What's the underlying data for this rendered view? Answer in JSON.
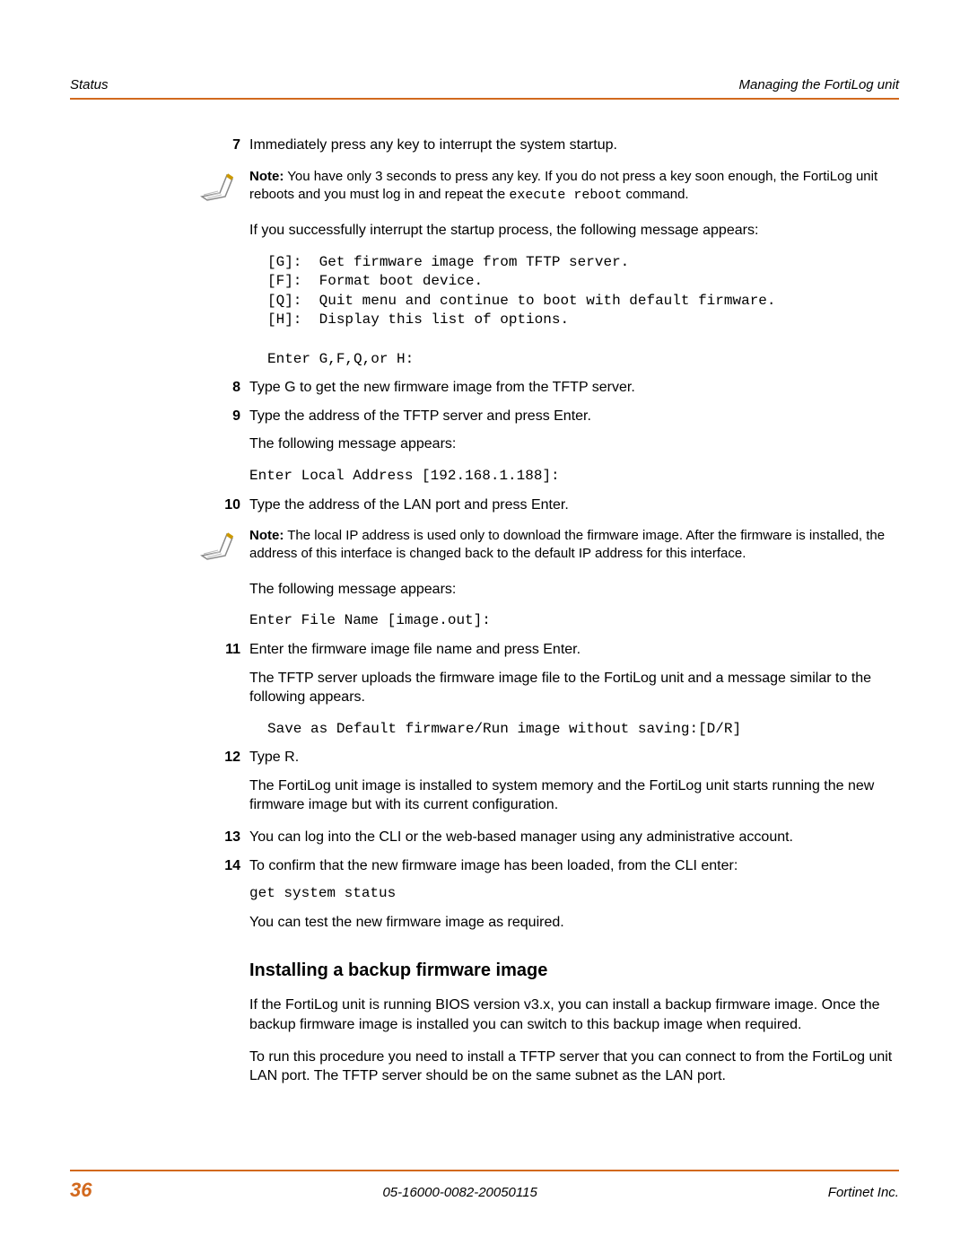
{
  "header": {
    "left": "Status",
    "right": "Managing the FortiLog unit"
  },
  "steps": {
    "s7": "Immediately press any key to interrupt the system startup.",
    "note1_pre": "Note:",
    "note1_text": " You have only 3 seconds to press any key. If you do not press a key soon enough, the FortiLog unit reboots and you must log in and repeat the ",
    "note1_cmd": "execute reboot",
    "note1_post": " command.",
    "interrupt_msg": "If you successfully interrupt the startup process, the following message appears:",
    "code_menu": "[G]:  Get firmware image from TFTP server.\n[F]:  Format boot device.\n[Q]:  Quit menu and continue to boot with default firmware.\n[H]:  Display this list of options.\n\nEnter G,F,Q,or H:",
    "s8": "Type G to get the new firmware image from the TFTP server.",
    "s9": "Type the address of the TFTP server and press Enter.",
    "s9_msg": "The following message appears:",
    "s9_code": "Enter Local Address [192.168.1.188]:",
    "s10": "Type the address of the LAN port and press Enter.",
    "note2_pre": "Note:",
    "note2_text": " The local IP address is used only to download the firmware image. After the firmware is installed, the address of this interface is changed back to the default IP address for this interface.",
    "s10_msg": "The following message appears:",
    "s10_code": "Enter File Name [image.out]:",
    "s11": "Enter the firmware image file name and press Enter.",
    "s11_p": "The TFTP server uploads the firmware image file to the FortiLog unit and a message similar to the following appears.",
    "s11_code": "Save as Default firmware/Run image without saving:[D/R]",
    "s12": "Type R.",
    "s12_p": "The FortiLog unit image is installed to system memory and the FortiLog unit starts running the new firmware image but with its current configuration.",
    "s13": "You can log into the CLI or the web-based manager using any administrative account.",
    "s14": "To confirm that the new firmware image has been loaded, from the CLI enter:",
    "s14_code": "get system status",
    "s14_p": "You can test the new firmware image as required."
  },
  "section": {
    "heading": "Installing a backup firmware image",
    "p1": "If the FortiLog unit is running BIOS version v3.x, you can install a backup firmware image. Once the backup firmware image is installed you can switch to this backup image when required.",
    "p2": "To run this procedure you need to install a TFTP server that you can connect to from the FortiLog unit LAN port. The TFTP server should be on the same subnet as the LAN port."
  },
  "footer": {
    "page": "36",
    "docid": "05-16000-0082-20050115",
    "company": "Fortinet Inc."
  },
  "num": {
    "n7": "7",
    "n8": "8",
    "n9": "9",
    "n10": "10",
    "n11": "11",
    "n12": "12",
    "n13": "13",
    "n14": "14"
  }
}
